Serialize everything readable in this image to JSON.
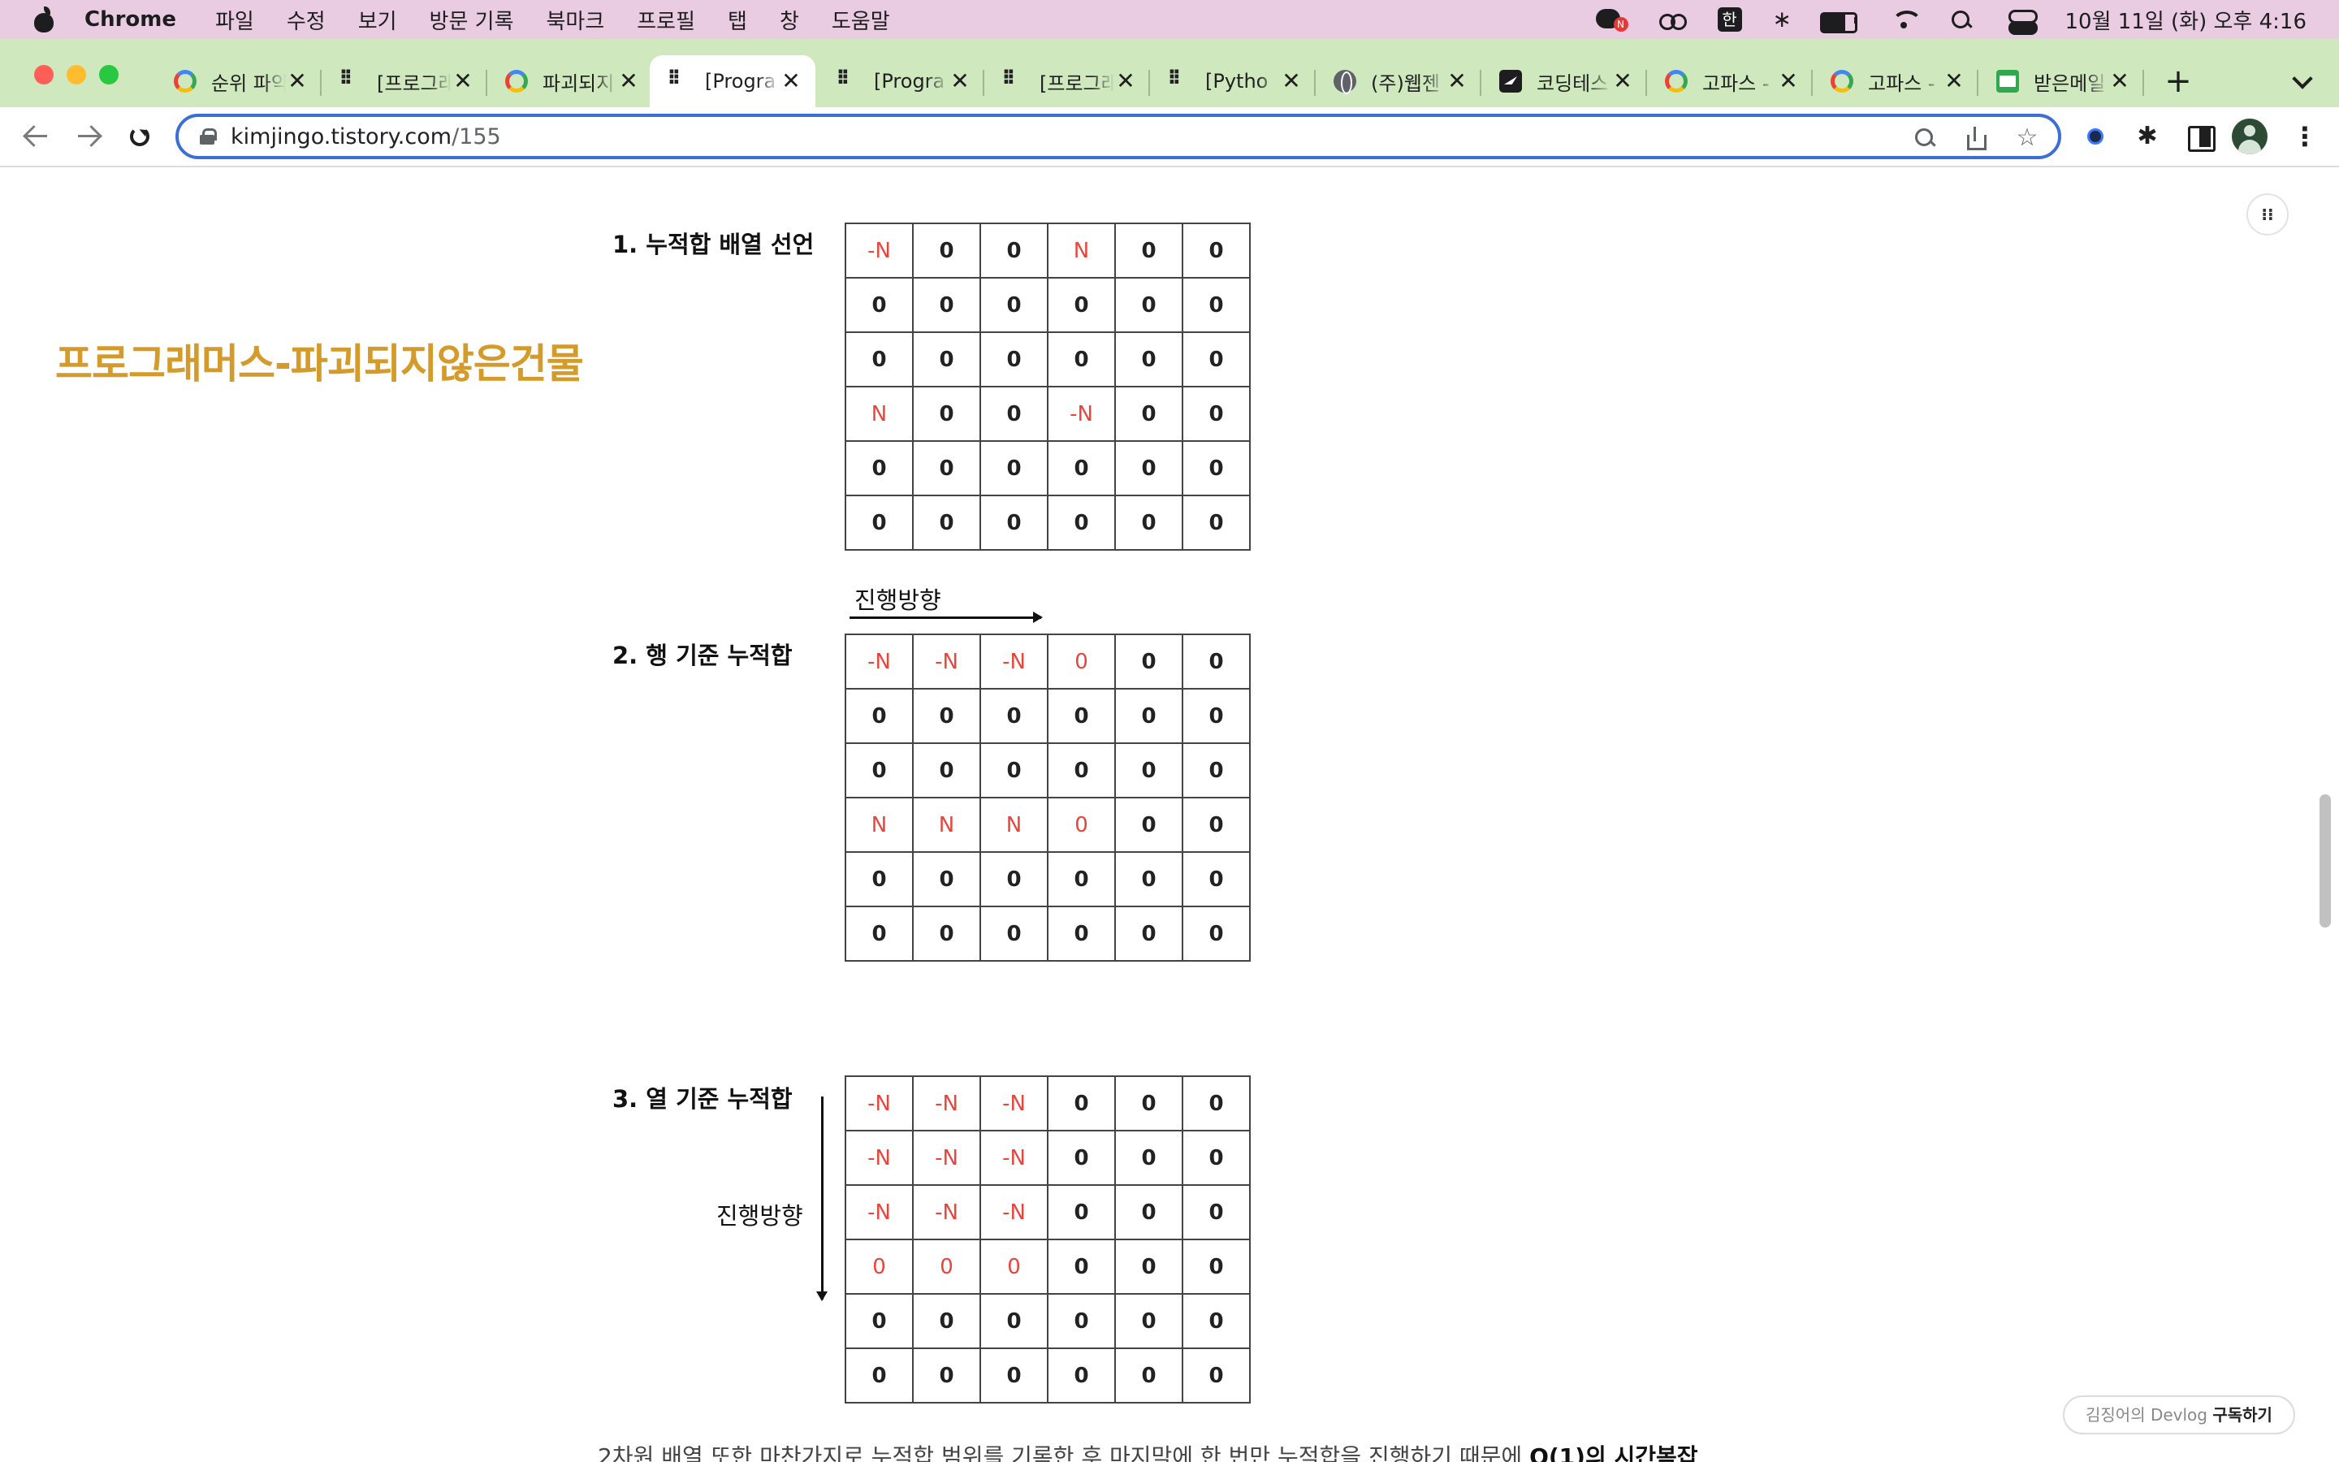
{
  "menubar": {
    "app_name": "Chrome",
    "items": [
      "파일",
      "수정",
      "보기",
      "방문 기록",
      "북마크",
      "프로필",
      "탭",
      "창",
      "도움말"
    ],
    "clock": "10월 11일 (화) 오후 4:16",
    "hangul_label": "한",
    "bluetooth_glyph": "∗"
  },
  "tabs": [
    {
      "label": "순위 파악",
      "icon": "google-icon"
    },
    {
      "label": "[프로그래",
      "icon": "tistory-icon"
    },
    {
      "label": "파괴되지",
      "icon": "google-icon"
    },
    {
      "label": "[Progra",
      "icon": "tistory-icon",
      "active": true
    },
    {
      "label": "[Progra",
      "icon": "tistory-icon"
    },
    {
      "label": "[프로그래",
      "icon": "tistory-icon"
    },
    {
      "label": "[Pytho",
      "icon": "tistory-icon"
    },
    {
      "label": "(주)웹젠",
      "icon": "globe-icon"
    },
    {
      "label": "코딩테스",
      "icon": "coding-icon"
    },
    {
      "label": "고파스 -",
      "icon": "google-icon"
    },
    {
      "label": "고파스 -",
      "icon": "google-icon"
    },
    {
      "label": "받은메일",
      "icon": "mail-icon"
    }
  ],
  "tab_close_glyph": "✕",
  "new_tab_glyph": "+",
  "omnibox": {
    "host": "kimjingo.tistory.com",
    "path": "/155"
  },
  "toolbar": {
    "star_glyph": "☆",
    "ext_glyph": "✱",
    "menu_glyph": "⋮"
  },
  "page": {
    "blog_title": "프로그래머스-파괴되지않은건물",
    "grid_menu_glyph": "⁝⁝",
    "step1_label": "1. 누적합 배열 선언",
    "step2_label": "2. 행 기준 누적합",
    "step3_label": "3. 열 기준 누적합",
    "direction_label": "진행방향",
    "matrix1": [
      [
        "-N",
        "0",
        "0",
        "N",
        "0",
        "0"
      ],
      [
        "0",
        "0",
        "0",
        "0",
        "0",
        "0"
      ],
      [
        "0",
        "0",
        "0",
        "0",
        "0",
        "0"
      ],
      [
        "N",
        "0",
        "0",
        "-N",
        "0",
        "0"
      ],
      [
        "0",
        "0",
        "0",
        "0",
        "0",
        "0"
      ],
      [
        "0",
        "0",
        "0",
        "0",
        "0",
        "0"
      ]
    ],
    "matrix1_red": [
      [
        0,
        0
      ],
      [
        0,
        3
      ],
      [
        3,
        0
      ],
      [
        3,
        3
      ]
    ],
    "matrix2": [
      [
        "-N",
        "-N",
        "-N",
        "0",
        "0",
        "0"
      ],
      [
        "0",
        "0",
        "0",
        "0",
        "0",
        "0"
      ],
      [
        "0",
        "0",
        "0",
        "0",
        "0",
        "0"
      ],
      [
        "N",
        "N",
        "N",
        "0",
        "0",
        "0"
      ],
      [
        "0",
        "0",
        "0",
        "0",
        "0",
        "0"
      ],
      [
        "0",
        "0",
        "0",
        "0",
        "0",
        "0"
      ]
    ],
    "matrix2_red": [
      [
        0,
        0
      ],
      [
        0,
        1
      ],
      [
        0,
        2
      ],
      [
        0,
        3
      ],
      [
        3,
        0
      ],
      [
        3,
        1
      ],
      [
        3,
        2
      ],
      [
        3,
        3
      ]
    ],
    "matrix3": [
      [
        "-N",
        "-N",
        "-N",
        "0",
        "0",
        "0"
      ],
      [
        "-N",
        "-N",
        "-N",
        "0",
        "0",
        "0"
      ],
      [
        "-N",
        "-N",
        "-N",
        "0",
        "0",
        "0"
      ],
      [
        "0",
        "0",
        "0",
        "0",
        "0",
        "0"
      ],
      [
        "0",
        "0",
        "0",
        "0",
        "0",
        "0"
      ],
      [
        "0",
        "0",
        "0",
        "0",
        "0",
        "0"
      ]
    ],
    "matrix3_red": [
      [
        0,
        0
      ],
      [
        0,
        1
      ],
      [
        0,
        2
      ],
      [
        1,
        0
      ],
      [
        1,
        1
      ],
      [
        1,
        2
      ],
      [
        2,
        0
      ],
      [
        2,
        1
      ],
      [
        2,
        2
      ],
      [
        3,
        0
      ],
      [
        3,
        1
      ],
      [
        3,
        2
      ]
    ],
    "bottom_text_plain": "2차원 배열 또한 마찬가지로 누적합 범위를 기록한 후 마지막에 한 번만 누적합을 진행하기 때문에 ",
    "bottom_text_bold": "O(1)의 시간복잡",
    "subscribe_blog": "김징어의 Devlog",
    "subscribe_action": "구독하기"
  },
  "colors": {
    "menubar_bg": "#e9cce2",
    "tabstrip_bg": "#cfe8be",
    "title_accent": "#d49a2a",
    "matrix_red": "#e8453c",
    "omnibox_focus": "#3b6fd6"
  }
}
